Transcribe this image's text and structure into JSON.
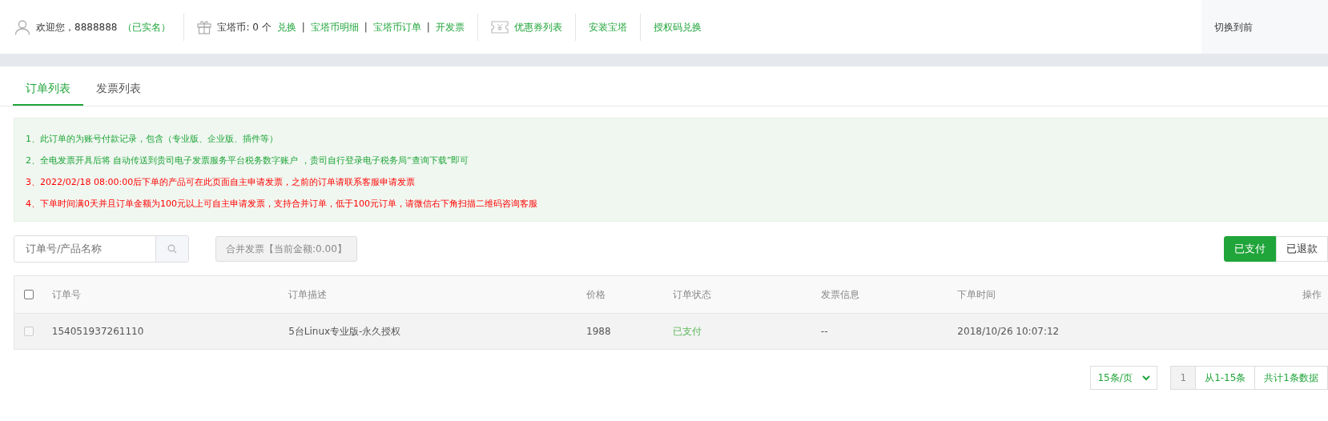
{
  "header": {
    "user": "欢迎您，8888888",
    "verified": "（已实名）",
    "coins": "宝塔币: 0 个",
    "separator": "|",
    "coin_links": [
      "兑换",
      "宝塔币明细",
      "宝塔币订单",
      "开发票"
    ],
    "links": [
      {
        "label": "优惠券列表",
        "kind": "coupon"
      },
      {
        "label": "安装宝塔",
        "kind": "plain"
      },
      {
        "label": "授权码兑换",
        "kind": "plain"
      }
    ],
    "switch": "切换到前"
  },
  "tabs": [
    {
      "label": "订单列表",
      "selected": true
    },
    {
      "label": "发票列表",
      "selected": false
    }
  ],
  "notices": [
    {
      "text": "1、此订单的为账号付款记录，包含（专业版、企业版、插件等）",
      "kind": "info"
    },
    {
      "text": "2、全电发票开具后将 自动传送到贵司电子发票服务平台税务数字账户 ，贵司自行登录电子税务局“查询下载”即可",
      "kind": "info"
    },
    {
      "text": "3、2022/02/18 08:00:00后下单的产品可在此页面自主申请发票，之前的订单请联系客服申请发票",
      "kind": "warn"
    },
    {
      "text": "4、下单时间满0天并且订单金额为100元以上可自主申请发票，支持合并订单，低于100元订单，请微信右下角扫描二维码咨询客服",
      "kind": "warn"
    }
  ],
  "search": {
    "placeholder": "订单号/产品名称"
  },
  "merge_button": {
    "label": "合并发票【当前金额:0.00】",
    "disabled": true
  },
  "filters": [
    {
      "label": "已支付",
      "selected": true
    },
    {
      "label": "已退款",
      "selected": false
    }
  ],
  "table": {
    "header_checked": false,
    "columns": [
      "订单号",
      "订单描述",
      "价格",
      "订单状态",
      "发票信息",
      "下单时间",
      "操作"
    ],
    "rows": [
      {
        "checked": false,
        "disabled": true,
        "cells": [
          "154051937261110",
          "5台Linux专业版-永久授权",
          "1988",
          {
            "label": "已支付",
            "color": "#5cb85c"
          },
          "--",
          "2018/10/26 10:07:12"
        ]
      }
    ]
  },
  "pagination": {
    "page_size": "15条/页",
    "pages": [
      {
        "label": "1",
        "selected": true
      }
    ],
    "range": "从1-15条",
    "total": "共计1条数据"
  }
}
